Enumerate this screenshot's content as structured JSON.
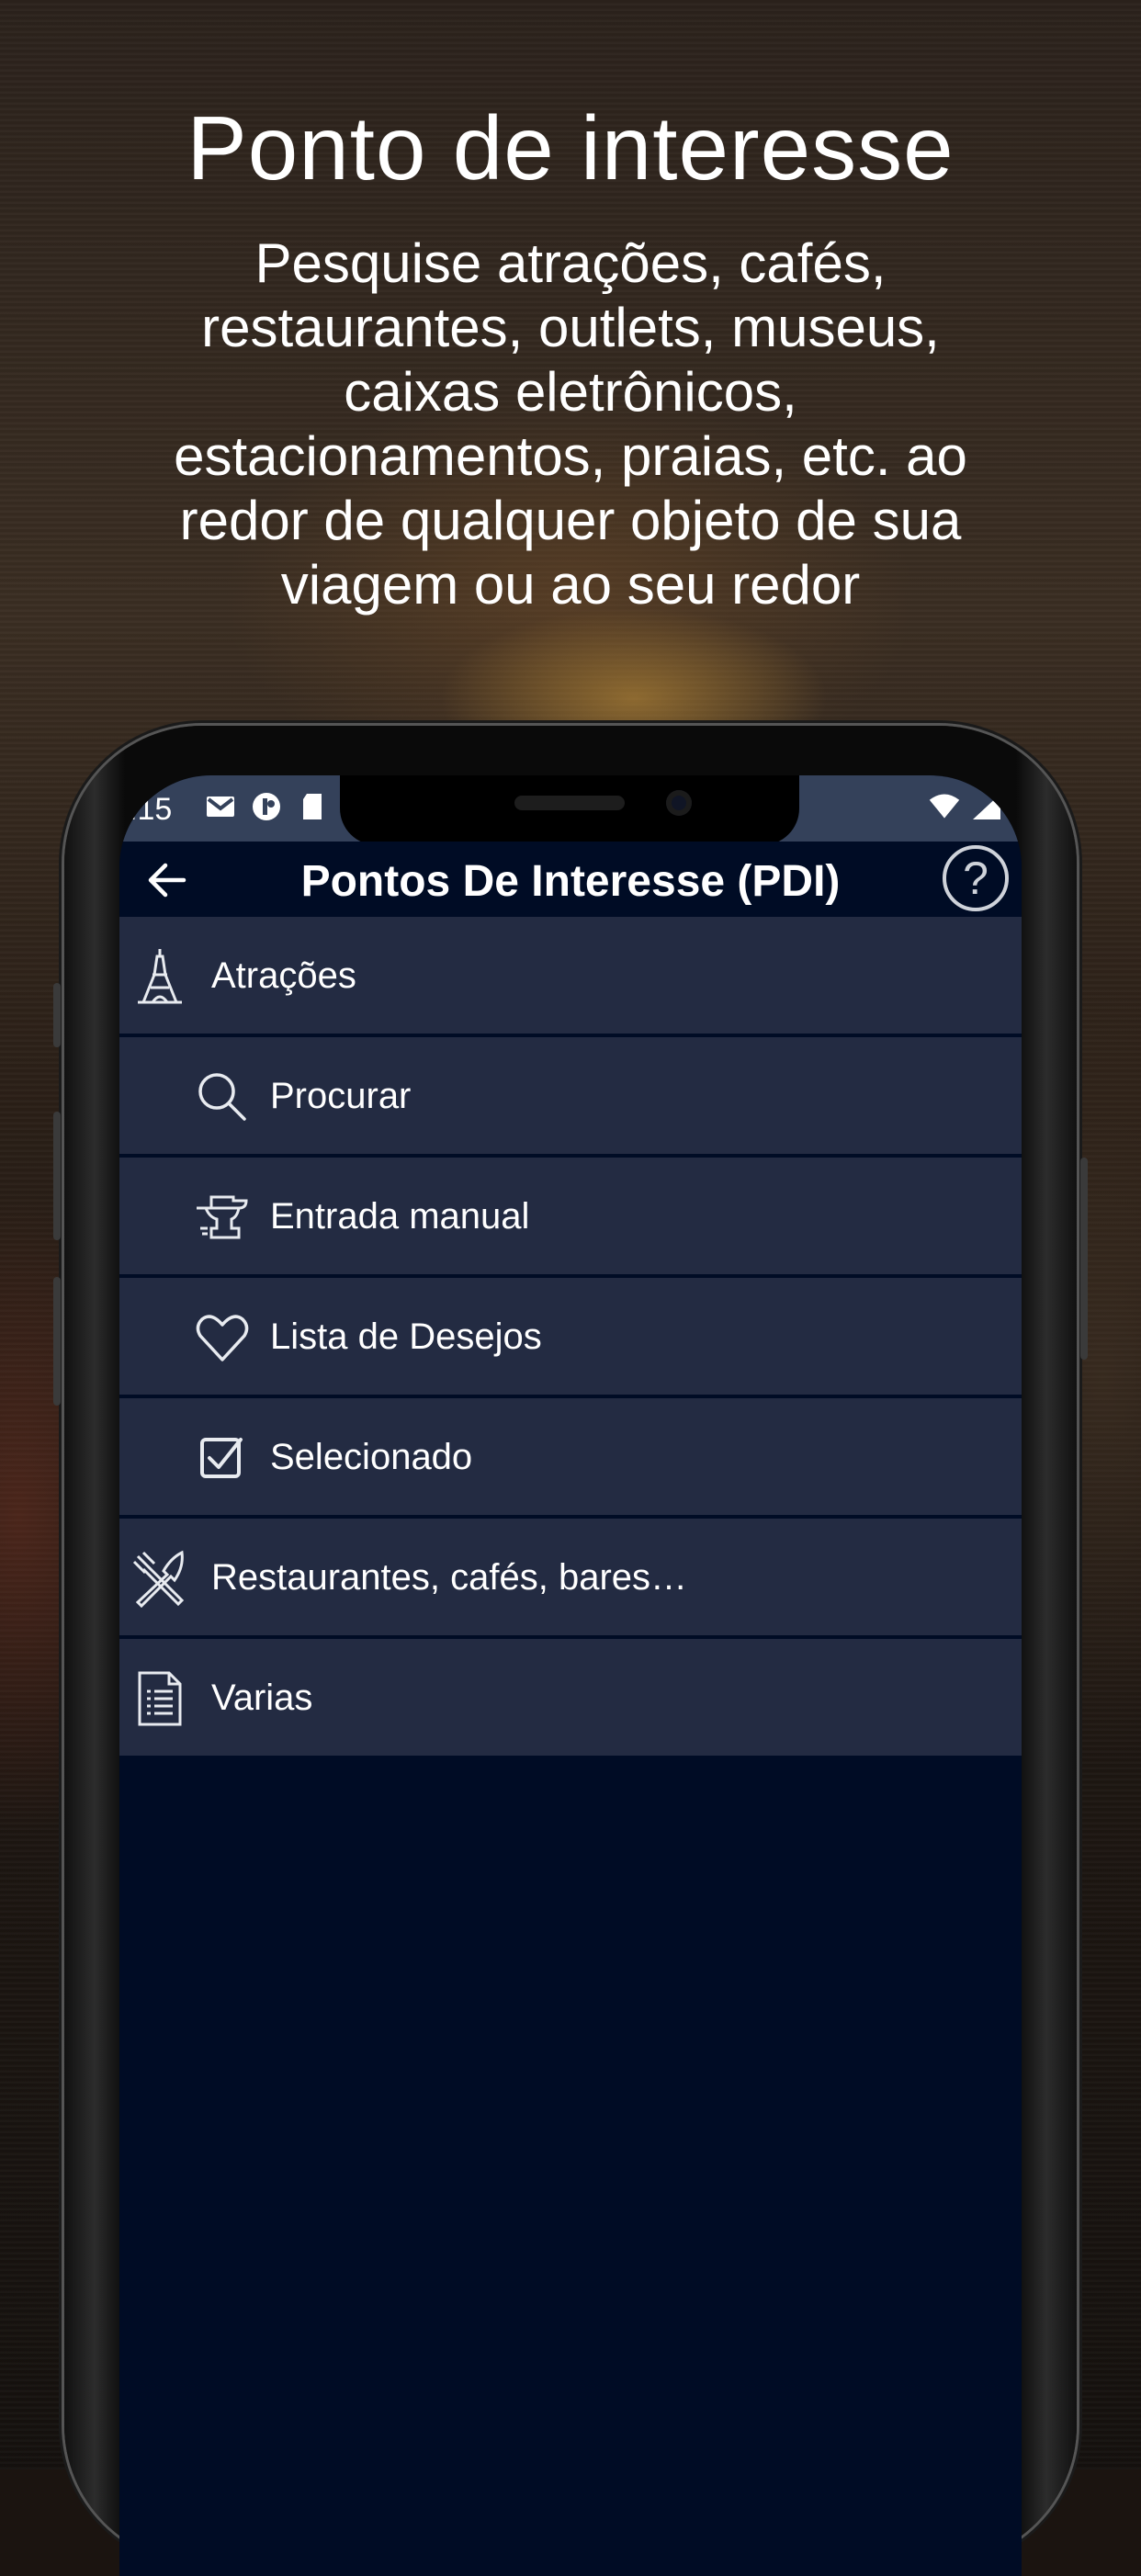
{
  "promo": {
    "headline": "Ponto de interesse",
    "description": "Pesquise atrações, cafés, restaurantes, outlets, museus, caixas eletrônicos, estacionamentos, praias, etc. ao redor de qualquer objeto de sua viagem ou ao seu redor"
  },
  "statusbar": {
    "time": ".15",
    "left_icons": [
      "gmail-icon",
      "circle-app-icon",
      "sd-card-icon"
    ],
    "right_icons": [
      "wifi-icon",
      "signal-icon"
    ]
  },
  "appbar": {
    "title": "Pontos De Interesse (PDI)",
    "help_label": "?"
  },
  "menu": {
    "items": [
      {
        "label": "Atrações",
        "icon": "eiffel-tower-icon",
        "level": 0
      },
      {
        "label": "Procurar",
        "icon": "search-icon",
        "level": 1
      },
      {
        "label": "Entrada manual",
        "icon": "anvil-icon",
        "level": 1
      },
      {
        "label": "Lista de Desejos",
        "icon": "heart-icon",
        "level": 1
      },
      {
        "label": "Selecionado",
        "icon": "checkbox-icon",
        "level": 1
      },
      {
        "label": "Restaurantes, cafés, bares…",
        "icon": "fork-knife-icon",
        "level": 0
      },
      {
        "label": "Varias",
        "icon": "document-list-icon",
        "level": 0
      }
    ]
  },
  "colors": {
    "screen_background": "#000c25",
    "menu_item_background": "#232b42",
    "statusbar_background": "#34415a",
    "text": "#ffffff"
  }
}
